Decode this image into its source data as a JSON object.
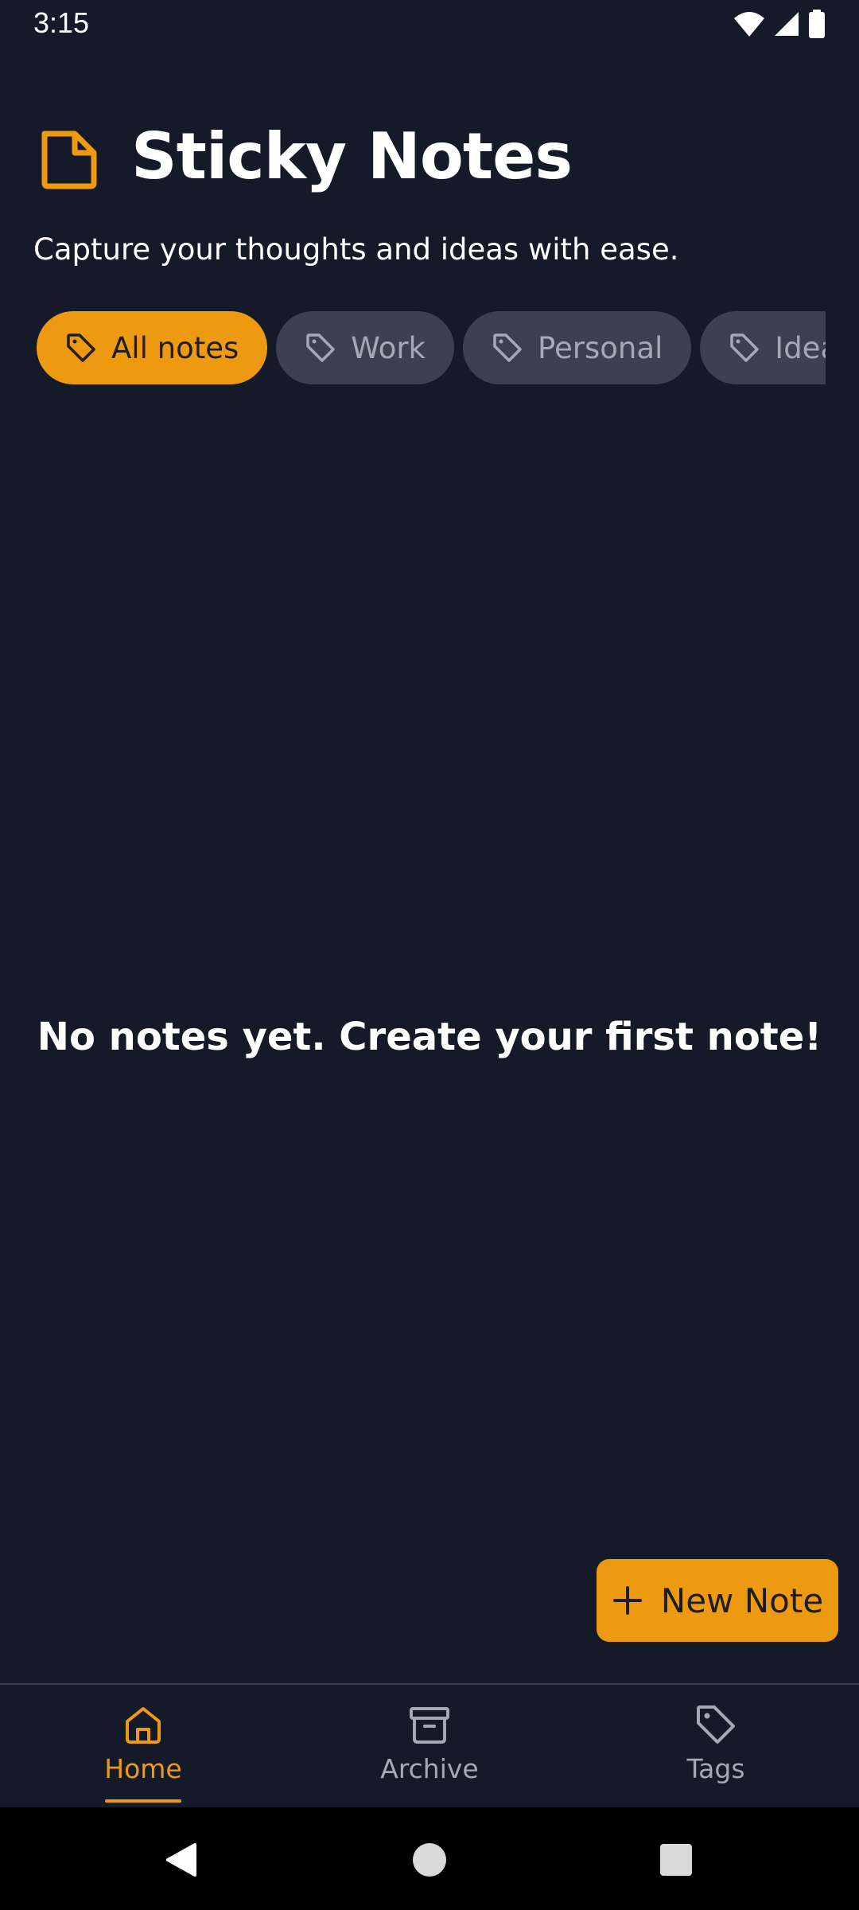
{
  "status_bar": {
    "time": "3:15",
    "icons": [
      "wifi-icon",
      "signal-icon",
      "battery-icon"
    ]
  },
  "header": {
    "logo_icon": "note-icon",
    "title": "Sticky Notes",
    "subtitle": "Capture your thoughts and ideas with ease."
  },
  "filters": [
    {
      "label": "All notes",
      "icon": "tag-icon",
      "active": true
    },
    {
      "label": "Work",
      "icon": "tag-icon",
      "active": false
    },
    {
      "label": "Personal",
      "icon": "tag-icon",
      "active": false
    },
    {
      "label": "Ideas",
      "icon": "tag-icon",
      "active": false
    }
  ],
  "empty_state": {
    "message": "No notes yet. Create your first note!"
  },
  "fab": {
    "icon": "plus-icon",
    "label": "New Note"
  },
  "bottom_nav": {
    "items": [
      {
        "label": "Home",
        "icon": "home-icon",
        "active": true
      },
      {
        "label": "Archive",
        "icon": "archive-icon",
        "active": false
      },
      {
        "label": "Tags",
        "icon": "tag-icon",
        "active": false
      }
    ]
  },
  "system_nav": {
    "buttons": [
      "back-icon",
      "home-circle-icon",
      "recents-icon"
    ]
  },
  "colors": {
    "background": "#141a28",
    "accent": "#ee9a10",
    "chip_inactive": "#3b4150",
    "muted_text": "#a4a9b4"
  }
}
